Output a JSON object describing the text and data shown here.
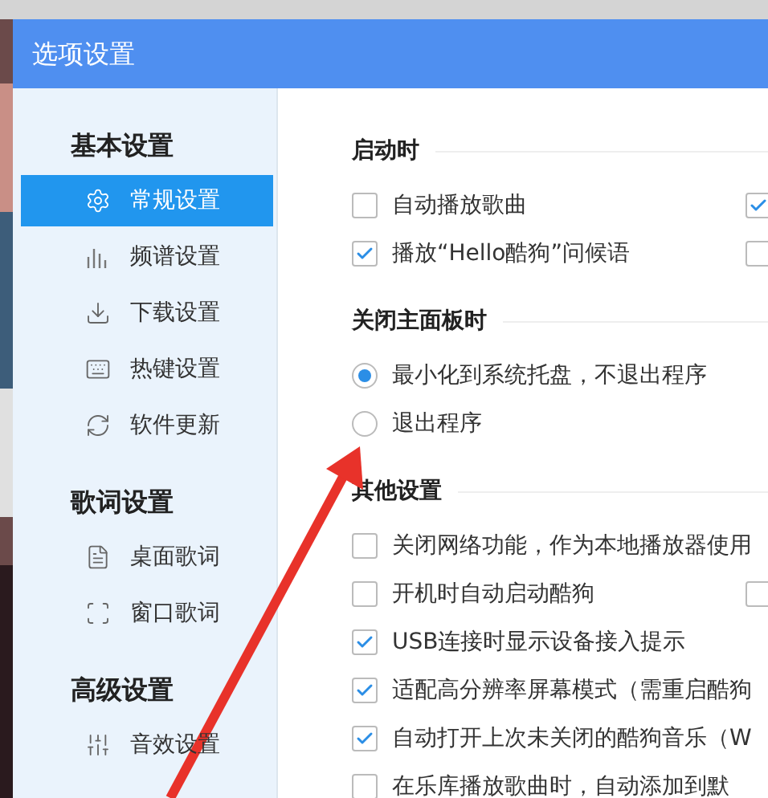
{
  "window": {
    "title": "选项设置"
  },
  "sidebar": {
    "groups": [
      {
        "heading": "基本设置",
        "items": [
          {
            "label": "常规设置",
            "selected": true
          },
          {
            "label": "频谱设置",
            "selected": false
          },
          {
            "label": "下载设置",
            "selected": false
          },
          {
            "label": "热键设置",
            "selected": false
          },
          {
            "label": "软件更新",
            "selected": false
          }
        ]
      },
      {
        "heading": "歌词设置",
        "items": [
          {
            "label": "桌面歌词",
            "selected": false
          },
          {
            "label": "窗口歌词",
            "selected": false
          }
        ]
      },
      {
        "heading": "高级设置",
        "items": [
          {
            "label": "音效设置",
            "selected": false
          }
        ]
      }
    ]
  },
  "sections": [
    {
      "heading": "启动时",
      "rows": [
        {
          "kind": "checkbox",
          "label": "自动播放歌曲",
          "checked": false,
          "right_checked": true
        },
        {
          "kind": "checkbox",
          "label": "播放“Hello酷狗”问候语",
          "checked": true,
          "right_checked": false
        }
      ]
    },
    {
      "heading": "关闭主面板时",
      "rows": [
        {
          "kind": "radio",
          "label": "最小化到系统托盘，不退出程序",
          "selected": true
        },
        {
          "kind": "radio",
          "label": "退出程序",
          "selected": false
        }
      ]
    },
    {
      "heading": "其他设置",
      "rows": [
        {
          "kind": "checkbox",
          "label": "关闭网络功能，作为本地播放器使用",
          "checked": false
        },
        {
          "kind": "checkbox",
          "label": "开机时自动启动酷狗",
          "checked": false,
          "right_checked": false
        },
        {
          "kind": "checkbox",
          "label": "USB连接时显示设备接入提示",
          "checked": true
        },
        {
          "kind": "checkbox",
          "label": "适配高分辨率屏幕模式（需重启酷狗",
          "checked": true
        },
        {
          "kind": "checkbox",
          "label": "自动打开上次未关闭的酷狗音乐（W",
          "checked": true
        },
        {
          "kind": "checkbox",
          "label": "在乐库播放歌曲时，自动添加到默",
          "checked": false
        }
      ]
    }
  ]
}
